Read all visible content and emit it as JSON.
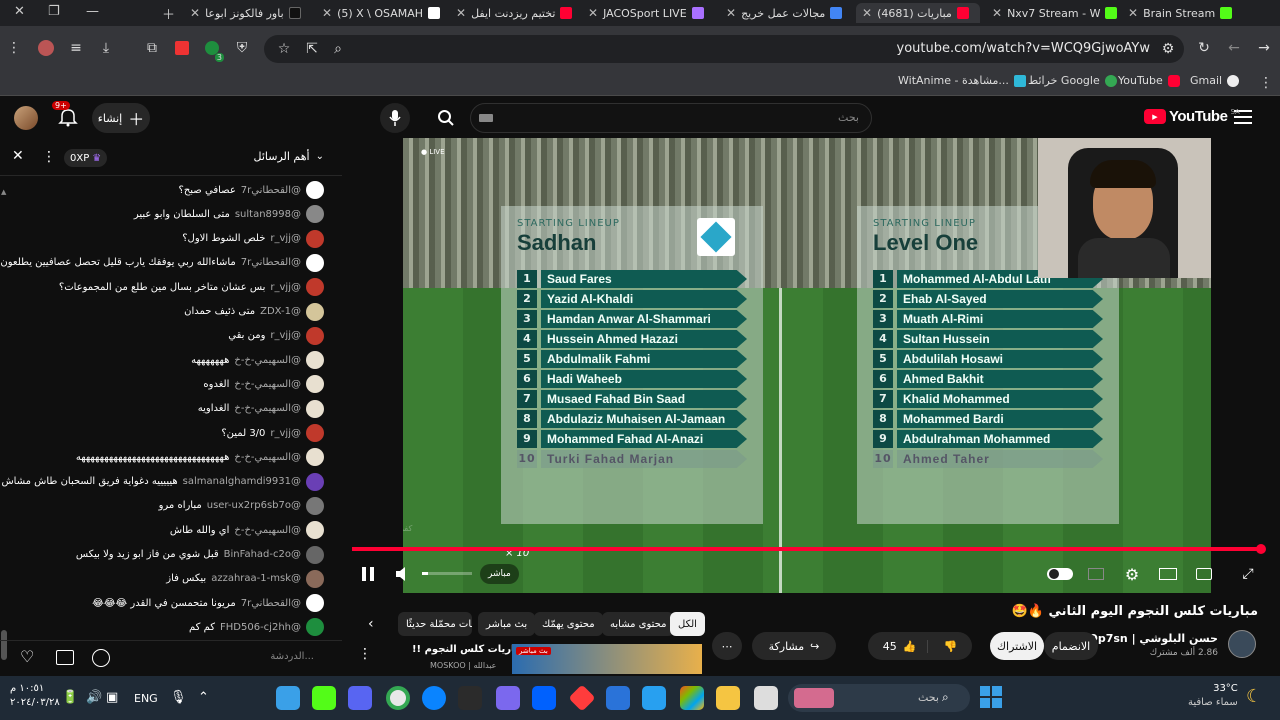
{
  "browser": {
    "tabs": [
      {
        "title": "Brain Stream",
        "color": "#53fc18"
      },
      {
        "title": "Nxv7 Stream - W",
        "color": "#53fc18"
      },
      {
        "title": "مباريات (4681)",
        "color": "#ff0033"
      },
      {
        "title": "مجالات عمل خريج",
        "color": "#4285f4"
      },
      {
        "title": "JACOSport LIVE",
        "color": "#a970ff"
      },
      {
        "title": "تختيم ريزدنت ايفل",
        "color": "#ff0033"
      },
      {
        "title": "(5) X \\ OSAMAH",
        "color": "#ffffff"
      },
      {
        "title": "باور فالكونز ابوعا",
        "color": "#111111"
      }
    ],
    "url": "youtube.com/watch?v=WCQ9GjwoAYw",
    "bookmarks": [
      "Gmail",
      "YouTube",
      "خرائط Google",
      "WitAnime - مشاهدة..."
    ],
    "extension_badge": "3"
  },
  "youtube": {
    "logo": "YouTube",
    "region": "SA",
    "search_placeholder": "بحث",
    "create_label": "إنشاء",
    "notif_count": "9+"
  },
  "chat": {
    "header": "أهم الرسائل",
    "xp": "0XP",
    "messages": [
      {
        "author": "@القحطاني7r",
        "text": "عصافي صبح؟",
        "color": "#ffffff"
      },
      {
        "author": "@sultan8998",
        "text": "متى السلطان وابو عبير",
        "color": "#888888"
      },
      {
        "author": "@r_vjj",
        "text": "خلص الشوط الاول؟",
        "color": "#c0392b"
      },
      {
        "author": "@القحطاني7r",
        "text": "ماشاءالله ربي يوفقك يارب قليل تحصل عصافيين يطلعون",
        "color": "#ffffff"
      },
      {
        "author": "@r_vjj",
        "text": "بس عشان متاخر بسال مين طلع من المجموعات؟",
        "color": "#c0392b"
      },
      {
        "author": "@ZDX-1",
        "text": "متى ذئيف حمدان",
        "color": "#d4c59a"
      },
      {
        "author": "@r_vjj",
        "text": "ومن بقي",
        "color": "#c0392b"
      },
      {
        "author": "@السهيمي-خ-خ",
        "text": "هههههههه",
        "color": "#e8e0d0"
      },
      {
        "author": "@السهيمي-خ-خ",
        "text": "الغدوه",
        "color": "#e8e0d0"
      },
      {
        "author": "@السهيمي-خ-خ",
        "text": "الغداويه",
        "color": "#e8e0d0"
      },
      {
        "author": "@r_vjj",
        "text": "3/0 لمين؟",
        "color": "#c0392b"
      },
      {
        "author": "@السهيمي-خ-خ",
        "text": "ههههههههههههههههههههههههههههههههه",
        "color": "#e8e0d0"
      },
      {
        "author": "@salmanalghamdi9931",
        "text": "هيييييه دغواية فريق السحبان طاش مشاش",
        "color": "#6a3fb5"
      },
      {
        "author": "@user-ux2rp6sb7o",
        "text": "مباراه مرو",
        "color": "#777777"
      },
      {
        "author": "@السهيمي-خ-خ",
        "text": "اي والله طاش",
        "color": "#e8e0d0"
      },
      {
        "author": "@BinFahad-c2o",
        "text": "قبل شوي من فاز ابو زيد ولا بيكس",
        "color": "#666666"
      },
      {
        "author": "@azzahraa-1-msk",
        "text": "بيكس فاز",
        "color": "#8a6a5a"
      },
      {
        "author": "@القحطاني7r",
        "text": "مريونا متحمسن في القدر 😂😂😂",
        "color": "#ffffff"
      },
      {
        "author": "@FHD506-cj2hh",
        "text": "كم كم",
        "color": "#1e8e3e"
      }
    ],
    "input_placeholder": "الدردشة..."
  },
  "video": {
    "watermark": "كفر صوت",
    "overlay_badge": "× 10",
    "teams": [
      {
        "name": "Sadhan",
        "players": [
          "Saud Fares",
          "Yazid Al-Khaldi",
          "Hamdan Anwar Al-Shammari",
          "Hussein Ahmed Hazazi",
          "Abdulmalik Fahmi",
          "Hadi Waheeb",
          "Musaed Fahad Bin Saad",
          "Abdulaziz Muhaisen Al-Jamaan",
          "Mohammed Fahad Al-Anazi",
          "Turki Fahad Marjan"
        ]
      },
      {
        "name": "Level One",
        "players": [
          "Mohammed Al-Abdul Latif",
          "Ehab Al-Sayed",
          "Muath Al-Rimi",
          "Sultan Hussein",
          "Abdulilah Hosawi",
          "Ahmed Bakhit",
          "Khalid Mohammed",
          "Mohammed Bardi",
          "Abdulrahman Mohammed",
          "Ahmed Taher"
        ]
      }
    ],
    "progress": 1.0,
    "live_label": "مباشر"
  },
  "below": {
    "chips": [
      "الكل",
      "محتوى مشابه",
      "محتوى يهمّك",
      "بث مباشر",
      "فيديوهات محمّلة حديثًا"
    ],
    "title": "مباريات كلس النجوم اليوم الثاني 🔥🤩",
    "channel": "حسن البلوشي | Op7sn",
    "subscribers": "2.86 ألف مشترك",
    "join": "الانضمام",
    "subscribe": "الاشتراك",
    "likes": "45",
    "share": "مشاركة",
    "rec_title": "تابع مباريات كلس النجوم !!",
    "rec_channel": "MOSKOO | عبدالله",
    "rec_badge": "بث مباشر"
  },
  "taskbar": {
    "search": "بحث",
    "lang": "ENG",
    "time": "١٠:٥١ م",
    "date": "٢٠٢٤/٠٣/٢٨",
    "temp": "33°C",
    "weather": "سماء صافية"
  }
}
